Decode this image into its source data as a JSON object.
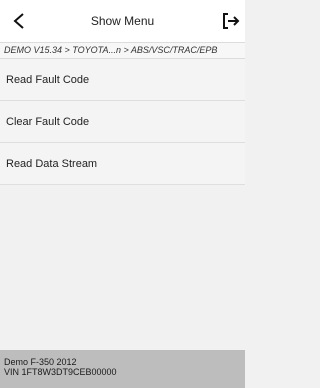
{
  "header": {
    "title": "Show Menu",
    "back_icon": "chevron-left-icon",
    "exit_icon": "exit-icon"
  },
  "breadcrumb": "DEMO V15.34 > TOYOTA...n > ABS/VSC/TRAC/EPB",
  "menu": {
    "items": [
      {
        "label": "Read Fault Code"
      },
      {
        "label": "Clear Fault Code"
      },
      {
        "label": "Read Data Stream"
      }
    ]
  },
  "footer": {
    "vehicle": "Demo F-350 2012",
    "vin": "VIN 1FT8W3DT9CEB00000"
  },
  "colors": {
    "background": "#f1f1f1",
    "header": "#ffffff",
    "footer": "#bdbdbd"
  }
}
